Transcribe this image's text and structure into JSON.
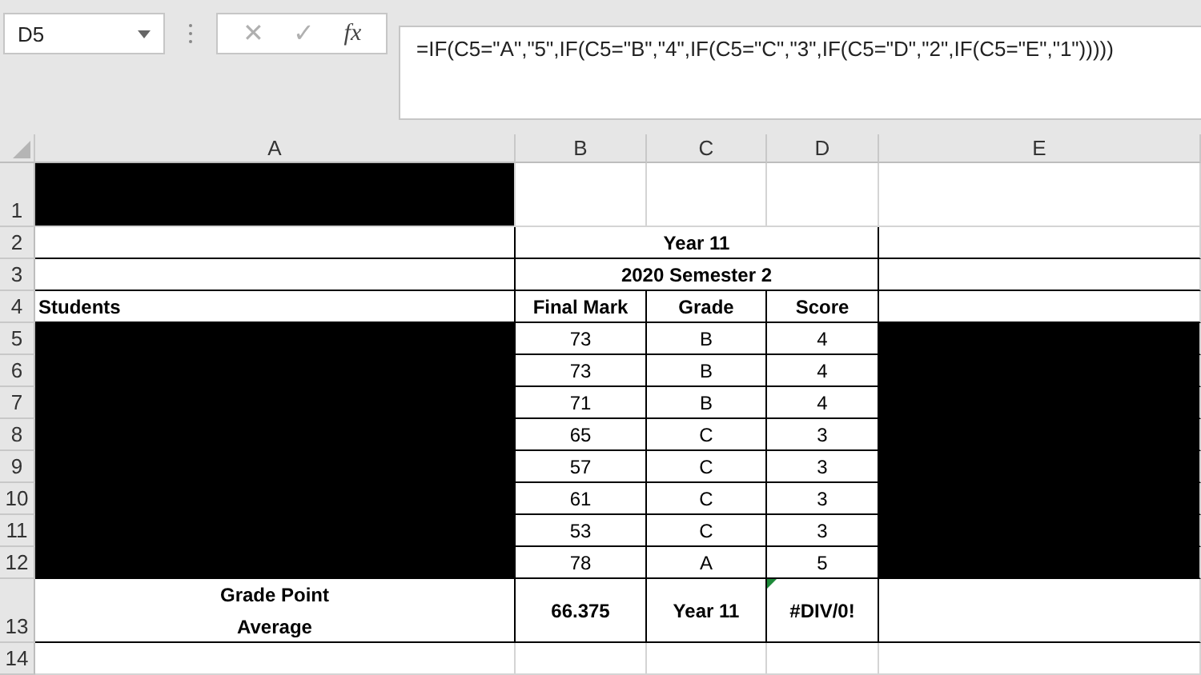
{
  "name_box": {
    "value": "D5"
  },
  "formula_bar": {
    "cancel_symbol": "✕",
    "enter_symbol": "✓",
    "function_symbol": "fx",
    "formula": "=IF(C5=\"A\",\"5\",IF(C5=\"B\",\"4\",IF(C5=\"C\",\"3\",IF(C5=\"D\",\"2\",IF(C5=\"E\",\"1\")))))"
  },
  "columns": [
    "A",
    "B",
    "C",
    "D",
    "E"
  ],
  "rows": [
    {
      "number": "1",
      "kind": "tall",
      "cells": [
        {
          "redacted": true,
          "warning": false
        },
        {
          "text": "",
          "redacted": false,
          "warning": false
        },
        {
          "text": "",
          "redacted": false,
          "warning": false
        },
        {
          "text": "",
          "redacted": false,
          "warning": false
        },
        {
          "text": "",
          "redacted": false,
          "warning": false
        }
      ]
    },
    {
      "number": "2",
      "kind": "header",
      "cells": [
        {
          "text": "",
          "redacted": false,
          "warning": false
        },
        {
          "text": "Year 11",
          "kind": "merged",
          "redacted": false,
          "warning": false
        },
        {
          "text": "",
          "redacted": false,
          "warning": false
        }
      ]
    },
    {
      "number": "3",
      "kind": "header",
      "cells": [
        {
          "text": "",
          "redacted": false,
          "warning": false
        },
        {
          "text": "2020 Semester 2",
          "kind": "merged",
          "redacted": false,
          "warning": false
        },
        {
          "text": "",
          "redacted": false,
          "warning": false
        }
      ]
    },
    {
      "number": "4",
      "kind": "header",
      "cells": [
        {
          "text": "Students",
          "redacted": false,
          "warning": false
        },
        {
          "text": "Final Mark",
          "redacted": false,
          "warning": false
        },
        {
          "text": "Grade",
          "redacted": false,
          "warning": false
        },
        {
          "text": "Score",
          "redacted": false,
          "warning": false
        },
        {
          "text": "",
          "redacted": false,
          "warning": false
        }
      ]
    },
    {
      "number": "5",
      "kind": "data",
      "cells": [
        {
          "redacted": true,
          "warning": false
        },
        {
          "text": "73",
          "redacted": false,
          "warning": false
        },
        {
          "text": "B",
          "redacted": false,
          "warning": false
        },
        {
          "text": "4",
          "redacted": false,
          "warning": false
        },
        {
          "redacted": true,
          "warning": false
        }
      ]
    },
    {
      "number": "6",
      "kind": "data",
      "cells": [
        {
          "redacted": true,
          "warning": false
        },
        {
          "text": "73",
          "redacted": false,
          "warning": false
        },
        {
          "text": "B",
          "redacted": false,
          "warning": false
        },
        {
          "text": "4",
          "redacted": false,
          "warning": false
        },
        {
          "redacted": true,
          "warning": false
        }
      ]
    },
    {
      "number": "7",
      "kind": "data",
      "cells": [
        {
          "redacted": true,
          "warning": false
        },
        {
          "text": "71",
          "redacted": false,
          "warning": false
        },
        {
          "text": "B",
          "redacted": false,
          "warning": false
        },
        {
          "text": "4",
          "redacted": false,
          "warning": false
        },
        {
          "redacted": true,
          "warning": false
        }
      ]
    },
    {
      "number": "8",
      "kind": "data",
      "cells": [
        {
          "redacted": true,
          "warning": false
        },
        {
          "text": "65",
          "redacted": false,
          "warning": false
        },
        {
          "text": "C",
          "redacted": false,
          "warning": false
        },
        {
          "text": "3",
          "redacted": false,
          "warning": false
        },
        {
          "redacted": true,
          "warning": false
        }
      ]
    },
    {
      "number": "9",
      "kind": "data",
      "cells": [
        {
          "redacted": true,
          "warning": false
        },
        {
          "text": "57",
          "redacted": false,
          "warning": false
        },
        {
          "text": "C",
          "redacted": false,
          "warning": false
        },
        {
          "text": "3",
          "redacted": false,
          "warning": false
        },
        {
          "redacted": true,
          "warning": false
        }
      ]
    },
    {
      "number": "10",
      "kind": "data",
      "cells": [
        {
          "redacted": true,
          "warning": false
        },
        {
          "text": "61",
          "redacted": false,
          "warning": false
        },
        {
          "text": "C",
          "redacted": false,
          "warning": false
        },
        {
          "text": "3",
          "redacted": false,
          "warning": false
        },
        {
          "redacted": true,
          "warning": false
        }
      ]
    },
    {
      "number": "11",
      "kind": "data",
      "cells": [
        {
          "redacted": true,
          "warning": false
        },
        {
          "text": "53",
          "redacted": false,
          "warning": false
        },
        {
          "text": "C",
          "redacted": false,
          "warning": false
        },
        {
          "text": "3",
          "redacted": false,
          "warning": false
        },
        {
          "redacted": true,
          "warning": false
        }
      ]
    },
    {
      "number": "12",
      "kind": "data",
      "cells": [
        {
          "redacted": true,
          "warning": false
        },
        {
          "text": "78",
          "redacted": false,
          "warning": false
        },
        {
          "text": "A",
          "redacted": false,
          "warning": false
        },
        {
          "text": "5",
          "redacted": false,
          "warning": false
        },
        {
          "redacted": true,
          "warning": false
        }
      ]
    },
    {
      "number": "13",
      "kind": "summary",
      "cells": [
        {
          "text": "Grade Point Average",
          "redacted": false,
          "warning": false
        },
        {
          "text": "66.375",
          "redacted": false,
          "warning": false
        },
        {
          "text": "Year 11",
          "redacted": false,
          "warning": false
        },
        {
          "text": "#DIV/0!",
          "redacted": false,
          "warning": true
        },
        {
          "text": "",
          "redacted": false,
          "warning": false
        }
      ]
    },
    {
      "number": "14",
      "kind": "blank",
      "cells": [
        {
          "text": "",
          "redacted": false,
          "warning": false
        },
        {
          "text": "",
          "redacted": false,
          "warning": false
        },
        {
          "text": "",
          "redacted": false,
          "warning": false
        },
        {
          "text": "",
          "redacted": false,
          "warning": false
        },
        {
          "text": "",
          "redacted": false,
          "warning": false
        }
      ]
    }
  ]
}
